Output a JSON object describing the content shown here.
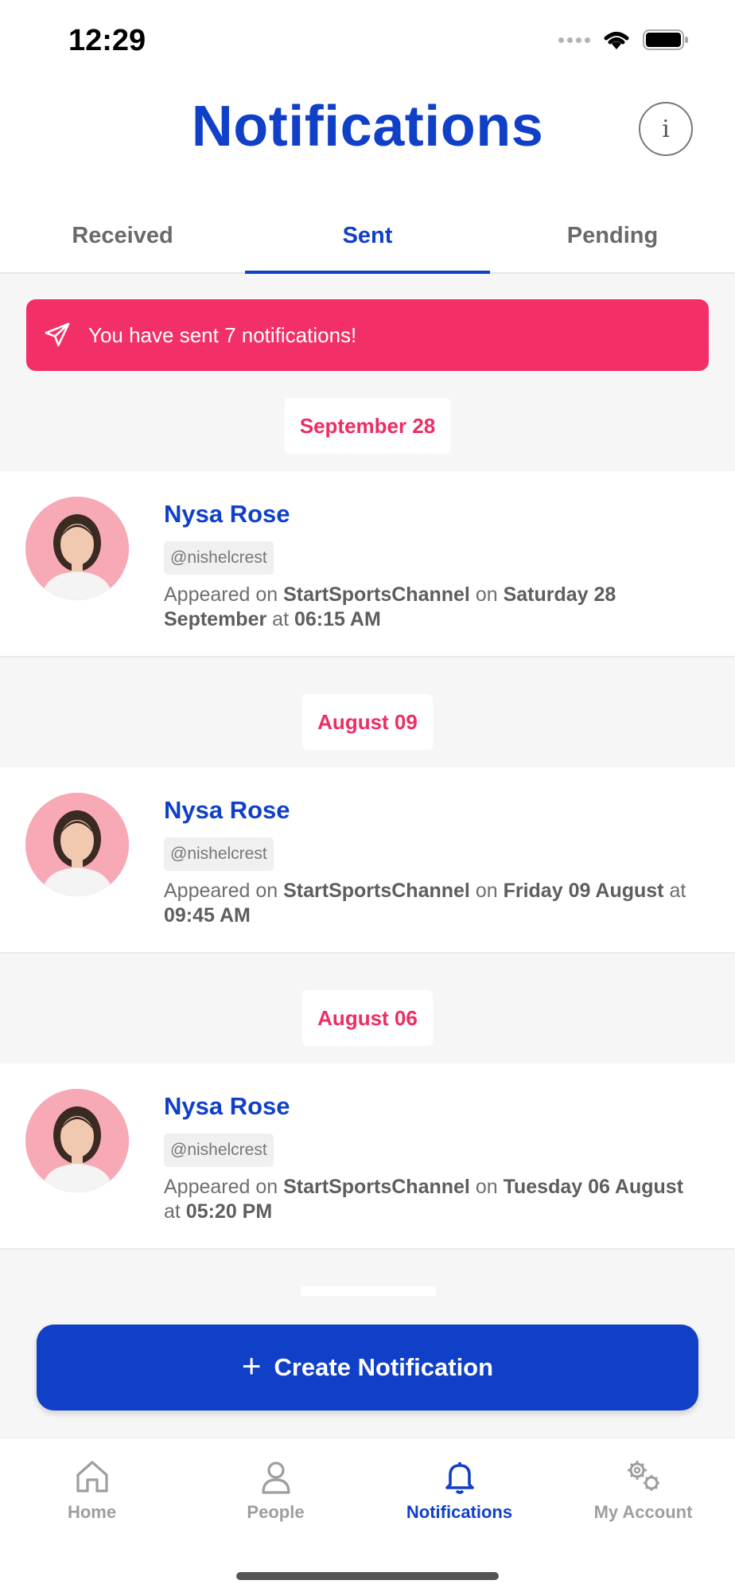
{
  "status_bar": {
    "time": "12:29"
  },
  "header": {
    "title": "Notifications",
    "info_label": "i"
  },
  "tabs": [
    {
      "label": "Received",
      "active": false
    },
    {
      "label": "Sent",
      "active": true
    },
    {
      "label": "Pending",
      "active": false
    }
  ],
  "banner": {
    "text": "You have sent 7 notifications!",
    "color": "#f22f66"
  },
  "groups": [
    {
      "date": "September 28",
      "item": {
        "name": "Nysa Rose",
        "handle": "@nishelcrest",
        "prefix": "Appeared on ",
        "channel": "StartSportsChannel",
        "on": " on ",
        "day": "Saturday 28 September",
        "at": " at ",
        "time": "06:15 AM"
      }
    },
    {
      "date": "August 09",
      "item": {
        "name": "Nysa Rose",
        "handle": "@nishelcrest",
        "prefix": "Appeared on ",
        "channel": "StartSportsChannel",
        "on": " on ",
        "day": "Friday 09 August",
        "at": " at ",
        "time": "09:45 AM"
      }
    },
    {
      "date": "August 06",
      "item": {
        "name": "Nysa Rose",
        "handle": "@nishelcrest",
        "prefix": "Appeared on ",
        "channel": "StartSportsChannel",
        "on": " on ",
        "day": "Tuesday 06 August",
        "at": " at ",
        "time": "05:20 PM"
      }
    }
  ],
  "cta": {
    "icon": "plus",
    "label": "Create Notification"
  },
  "bottom_nav": [
    {
      "label": "Home",
      "icon": "home-icon",
      "active": false
    },
    {
      "label": "People",
      "icon": "person-icon",
      "active": false
    },
    {
      "label": "Notifications",
      "icon": "bell-icon",
      "active": true
    },
    {
      "label": "My Account",
      "icon": "gears-icon",
      "active": false
    }
  ],
  "colors": {
    "brand_blue": "#1040c8",
    "accent_pink": "#f22f66"
  }
}
